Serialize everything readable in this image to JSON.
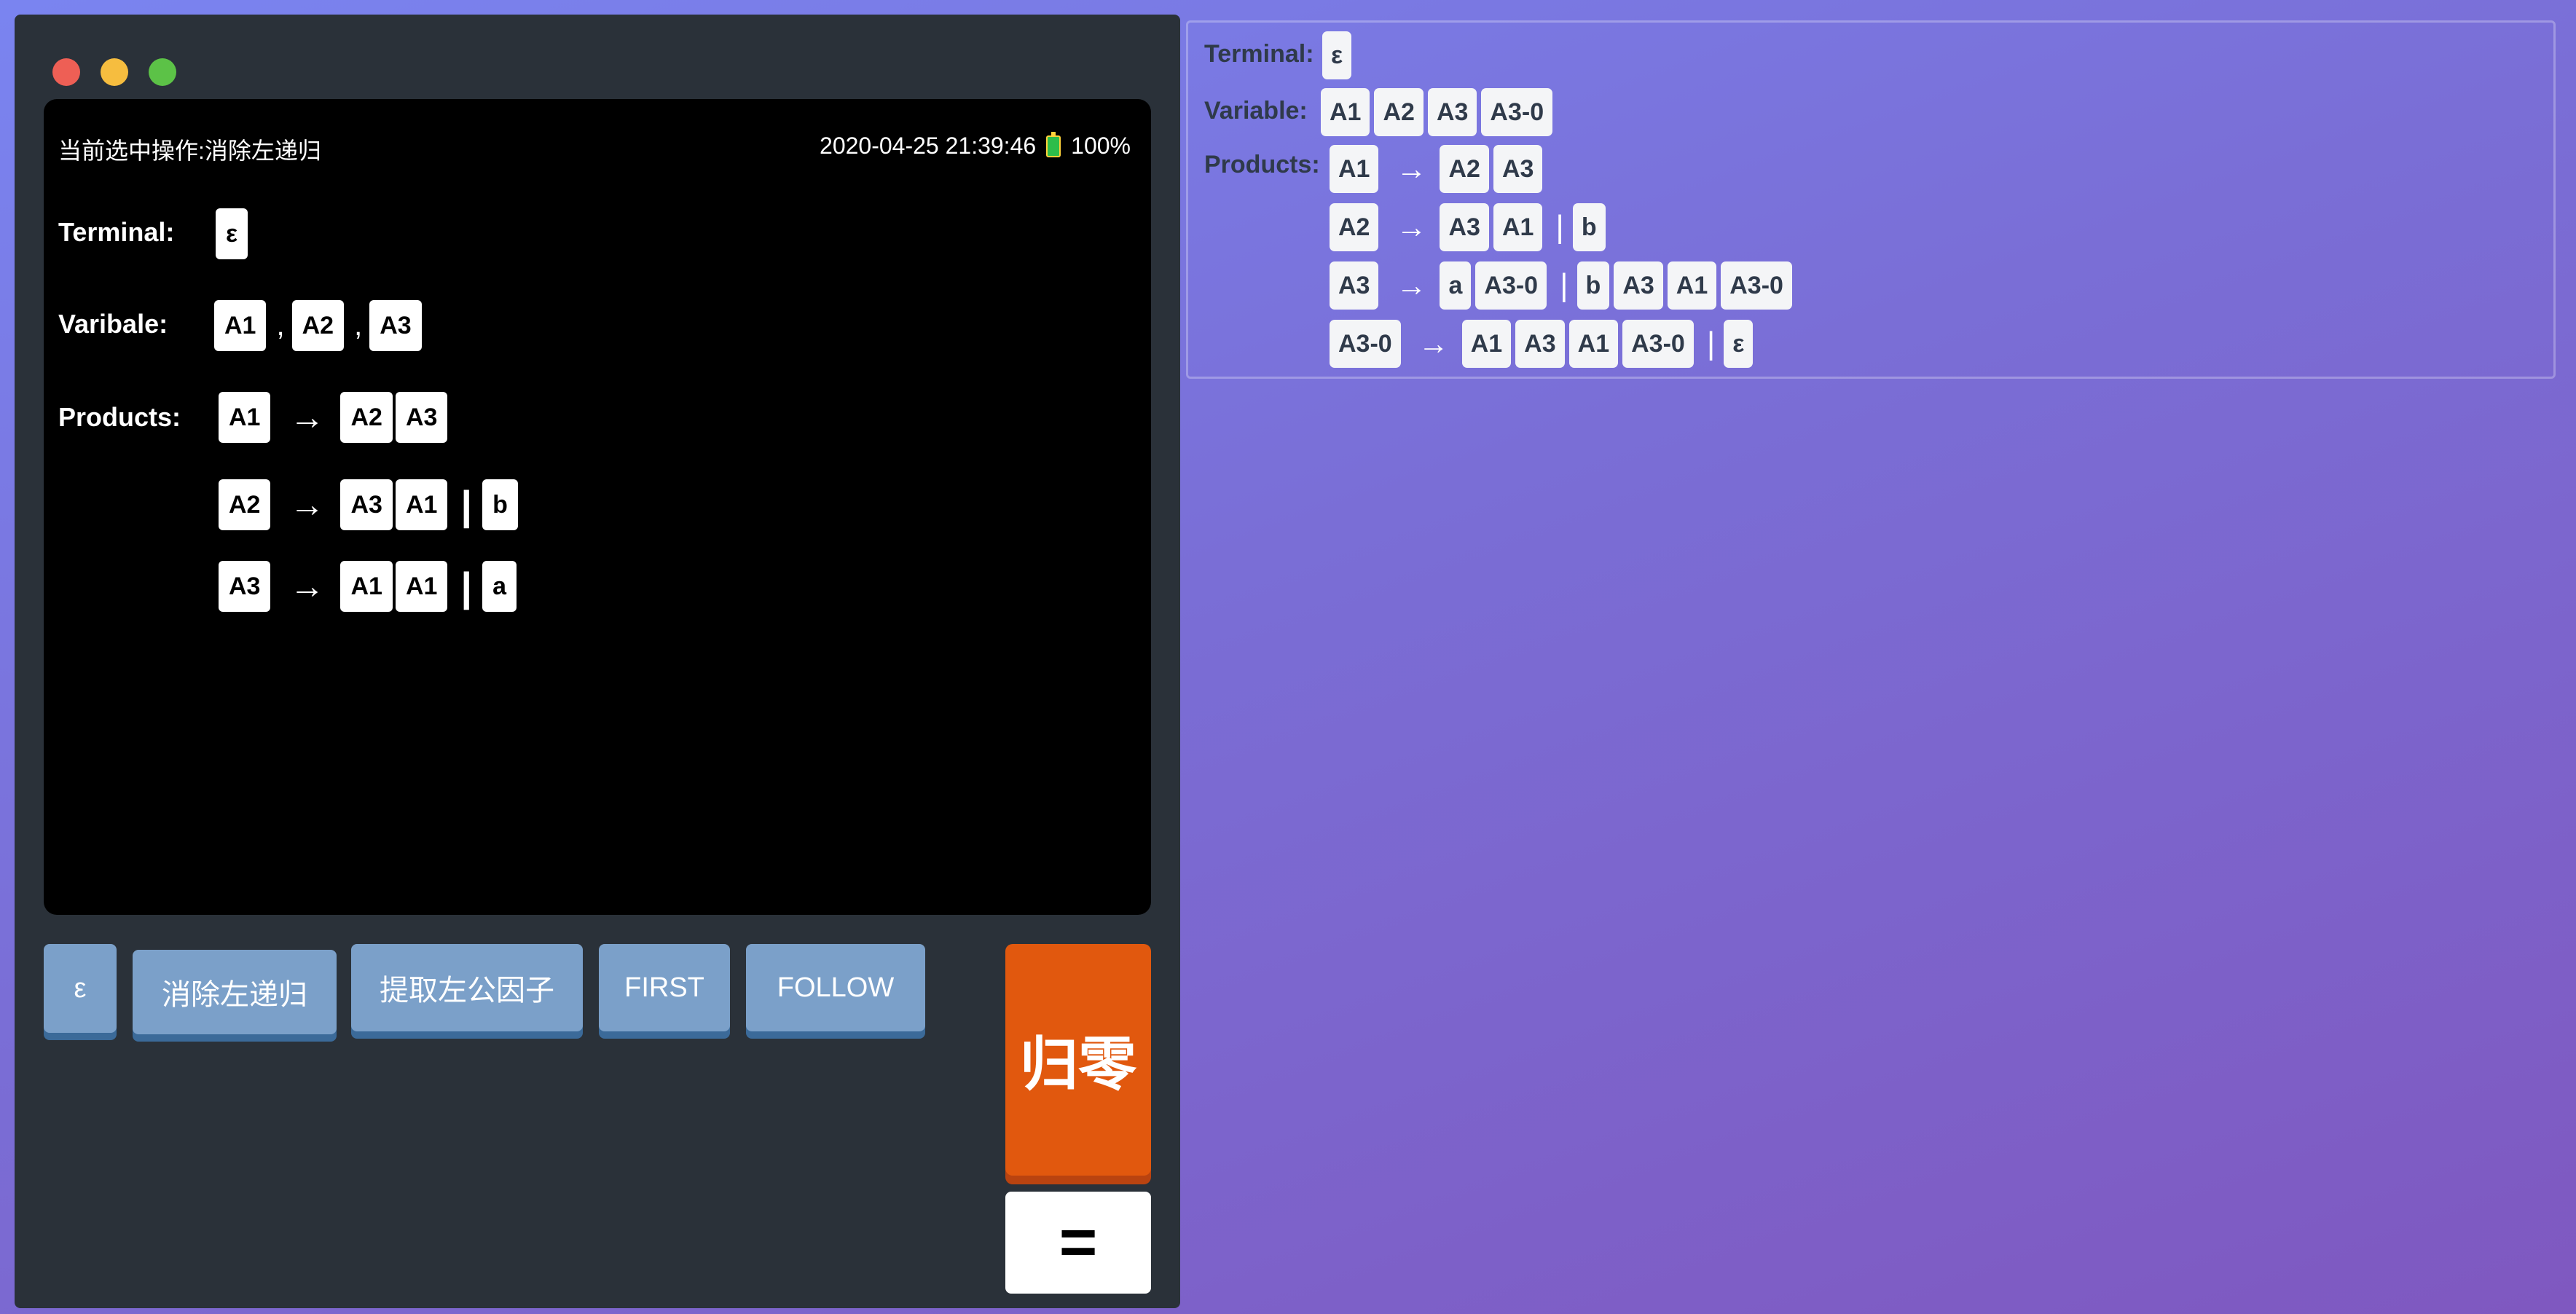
{
  "screen": {
    "current_op": "当前选中操作:消除左递归",
    "datetime": "2020-04-25 21:39:46",
    "battery": "100%",
    "terminal_label": "Terminal:",
    "variable_label": "Varibale:",
    "products_label": "Products:",
    "terminals": [
      "ε"
    ],
    "variables": [
      "A1",
      "A2",
      "A3"
    ],
    "comma": ",",
    "arrow": "→",
    "bar": "|",
    "productions": [
      {
        "lhs": "A1",
        "alts": [
          [
            "A2",
            "A3"
          ]
        ]
      },
      {
        "lhs": "A2",
        "alts": [
          [
            "A3",
            "A1"
          ],
          [
            "b"
          ]
        ]
      },
      {
        "lhs": "A3",
        "alts": [
          [
            "A1",
            "A1"
          ],
          [
            "a"
          ]
        ]
      }
    ]
  },
  "buttons": {
    "epsilon": "ε",
    "eliminate_left_recursion": "消除左递归",
    "extract_left_factor": "提取左公因子",
    "first": "FIRST",
    "follow": "FOLLOW",
    "clear": "归零",
    "equals": "="
  },
  "result": {
    "terminal_label": "Terminal:",
    "variable_label": "Variable:",
    "products_label": "Products:",
    "terminals": [
      "ε"
    ],
    "variables": [
      "A1",
      "A2",
      "A3",
      "A3-0"
    ],
    "arrow": "→",
    "bar": "|",
    "productions": [
      {
        "lhs": "A1",
        "alts": [
          [
            "A2",
            "A3"
          ]
        ]
      },
      {
        "lhs": "A2",
        "alts": [
          [
            "A3",
            "A1"
          ],
          [
            "b"
          ]
        ]
      },
      {
        "lhs": "A3",
        "alts": [
          [
            "a",
            "A3-0"
          ],
          [
            "b",
            "A3",
            "A1",
            "A3-0"
          ]
        ]
      },
      {
        "lhs": "A3-0",
        "alts": [
          [
            "A1",
            "A3",
            "A1",
            "A3-0"
          ],
          [
            "ε"
          ]
        ]
      }
    ]
  },
  "colors": {
    "clear_button": "#e1580e",
    "function_button": "#7ba0c9",
    "panel": "#2a3139",
    "screen": "#000000"
  }
}
